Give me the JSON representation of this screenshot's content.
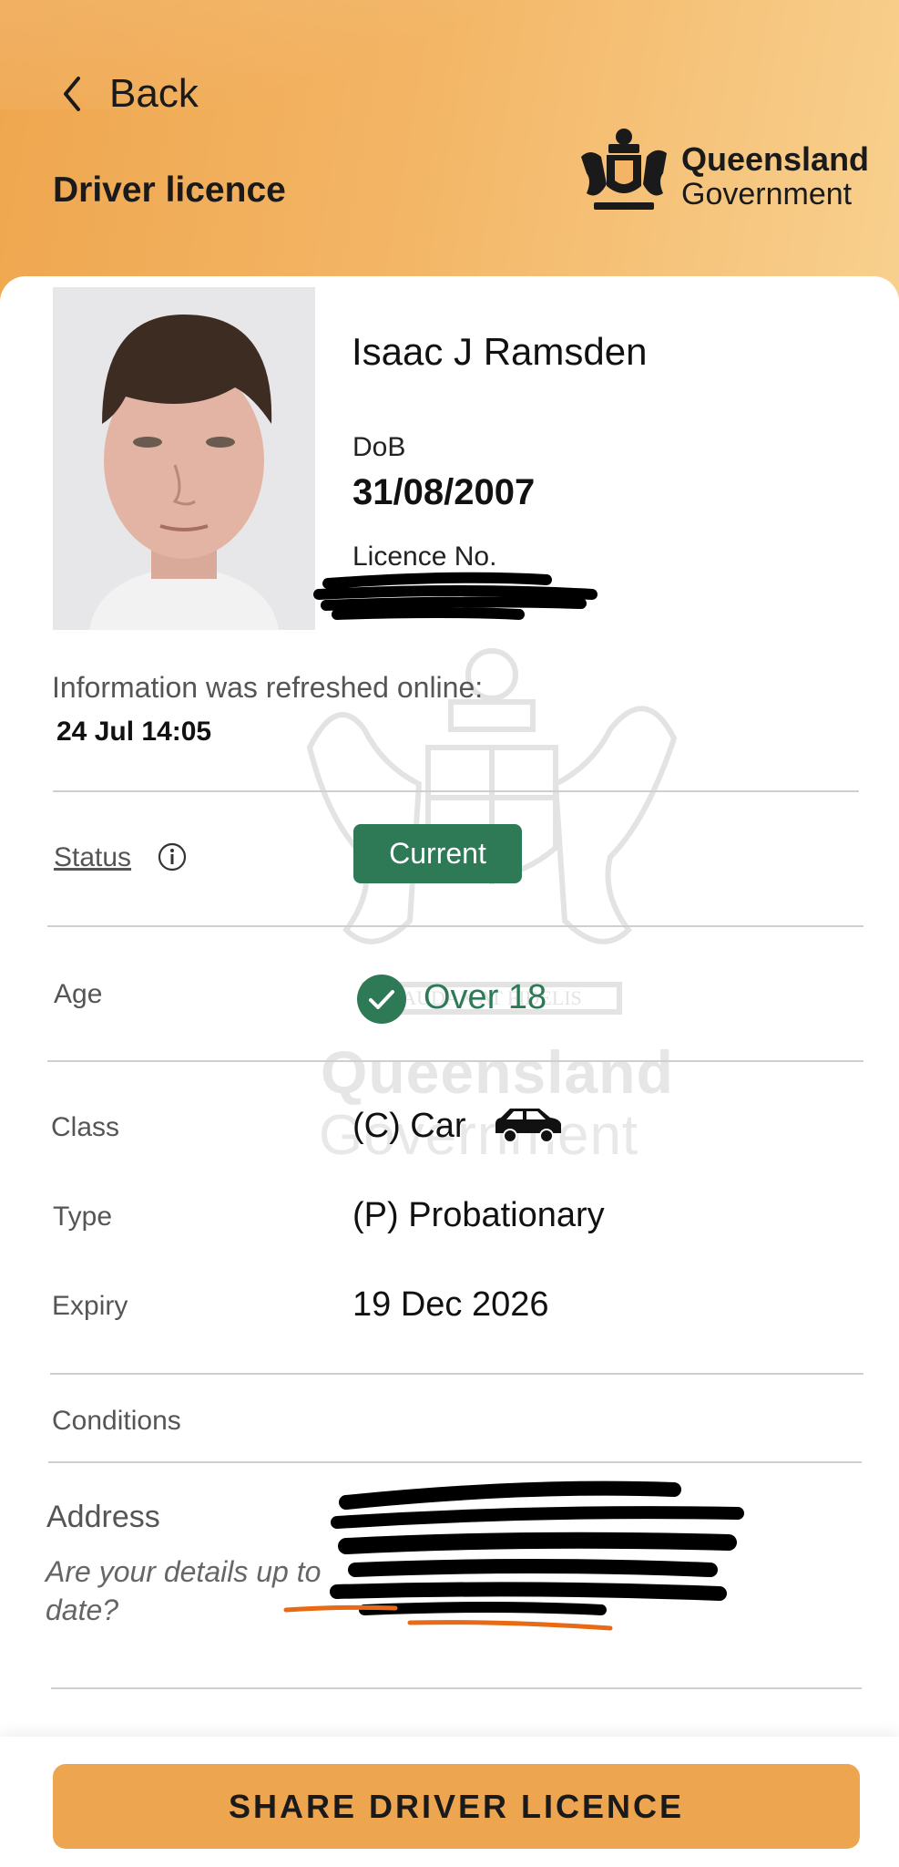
{
  "header": {
    "back_label": "Back",
    "title": "Driver licence",
    "logo_line1": "Queensland",
    "logo_line2": "Government"
  },
  "watermark": {
    "line1": "Queensland",
    "line2": "Government",
    "motto": "AUDAX AT FIDELIS"
  },
  "licence": {
    "name": "Isaac J Ramsden",
    "dob_label": "DoB",
    "dob": "31/08/2007",
    "licence_no_label": "Licence No."
  },
  "refresh": {
    "label": "Information was refreshed online:",
    "value": "24 Jul 14:05"
  },
  "rows": {
    "status_label": "Status",
    "status_value": "Current",
    "age_label": "Age",
    "age_value": "Over 18",
    "class_label": "Class",
    "class_value": "(C) Car",
    "type_label": "Type",
    "type_value": "(P) Probationary",
    "expiry_label": "Expiry",
    "expiry_value": "19 Dec 2026",
    "conditions_label": "Conditions",
    "address_label": "Address",
    "address_link": "Are your details up to date?"
  },
  "share_button": "SHARE DRIVER LICENCE",
  "colors": {
    "accent": "#eea54f",
    "status_green": "#2e7a57"
  },
  "icons": [
    "chevron-left-icon",
    "queensland-crest-icon",
    "info-icon",
    "check-circle-icon",
    "car-icon"
  ]
}
